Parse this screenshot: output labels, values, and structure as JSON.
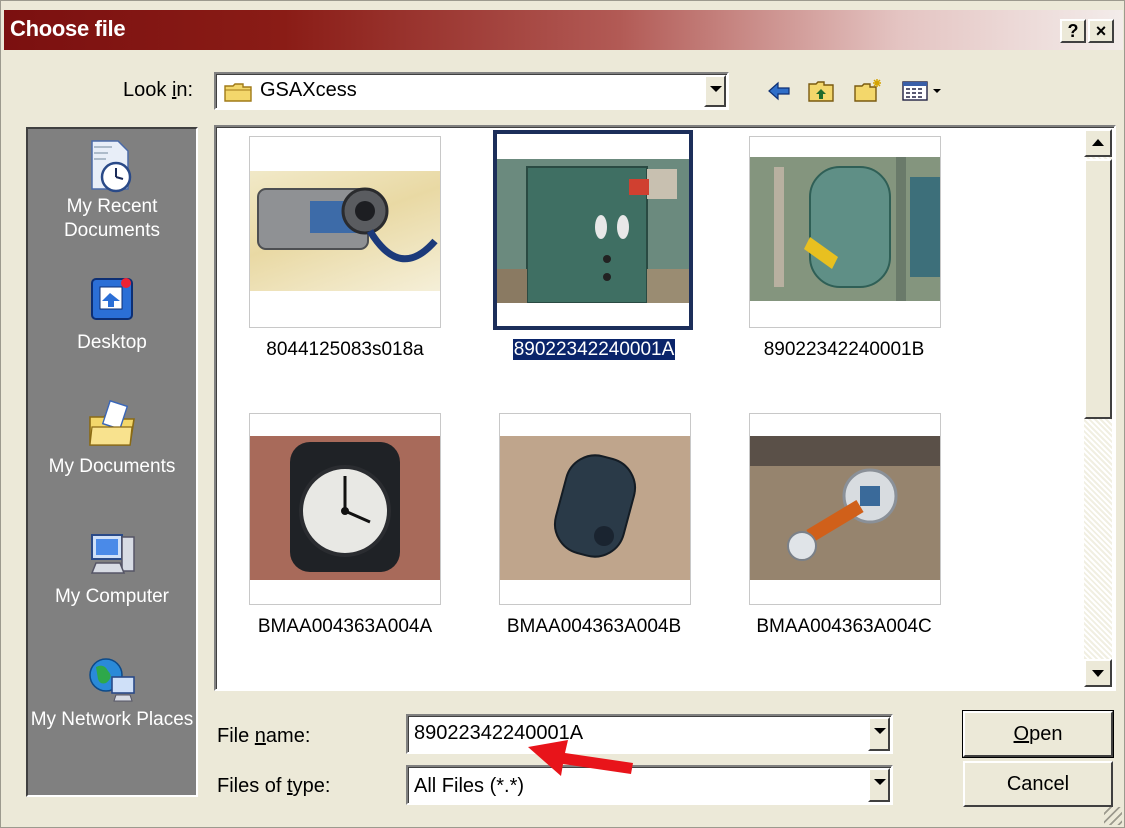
{
  "window": {
    "title": "Choose file",
    "help_label": "?",
    "close_label": "×"
  },
  "lookin": {
    "label_prefix": "Look ",
    "label_accel": "i",
    "label_suffix": "n:",
    "value": "GSAXcess",
    "icon": "folder-icon"
  },
  "toolbar": {
    "icons": [
      "back-arrow-icon",
      "up-folder-icon",
      "new-folder-icon",
      "views-menu-icon"
    ]
  },
  "places": [
    {
      "label": "My Recent Documents",
      "icon": "recent-documents-icon"
    },
    {
      "label": "Desktop",
      "icon": "desktop-icon"
    },
    {
      "label": "My Documents",
      "icon": "my-documents-icon"
    },
    {
      "label": "My Computer",
      "icon": "my-computer-icon"
    },
    {
      "label": "My Network Places",
      "icon": "network-places-icon"
    }
  ],
  "files": [
    {
      "name": "8044125083s018a",
      "selected": false
    },
    {
      "name": "89022342240001A",
      "selected": true
    },
    {
      "name": "89022342240001B",
      "selected": false
    },
    {
      "name": "BMAA004363A004A",
      "selected": false
    },
    {
      "name": "BMAA004363A004B",
      "selected": false
    },
    {
      "name": "BMAA004363A004C",
      "selected": false
    }
  ],
  "filename": {
    "label_prefix": "File ",
    "label_accel": "n",
    "label_suffix": "ame:",
    "value": "89022342240001A"
  },
  "filetype": {
    "label_prefix": "Files of ",
    "label_accel": "t",
    "label_suffix": "ype:",
    "value": "All Files (*.*)"
  },
  "buttons": {
    "open_accel": "O",
    "open_rest": "pen",
    "cancel": "Cancel"
  },
  "annotation": {
    "arrow_color": "#e8141a"
  }
}
